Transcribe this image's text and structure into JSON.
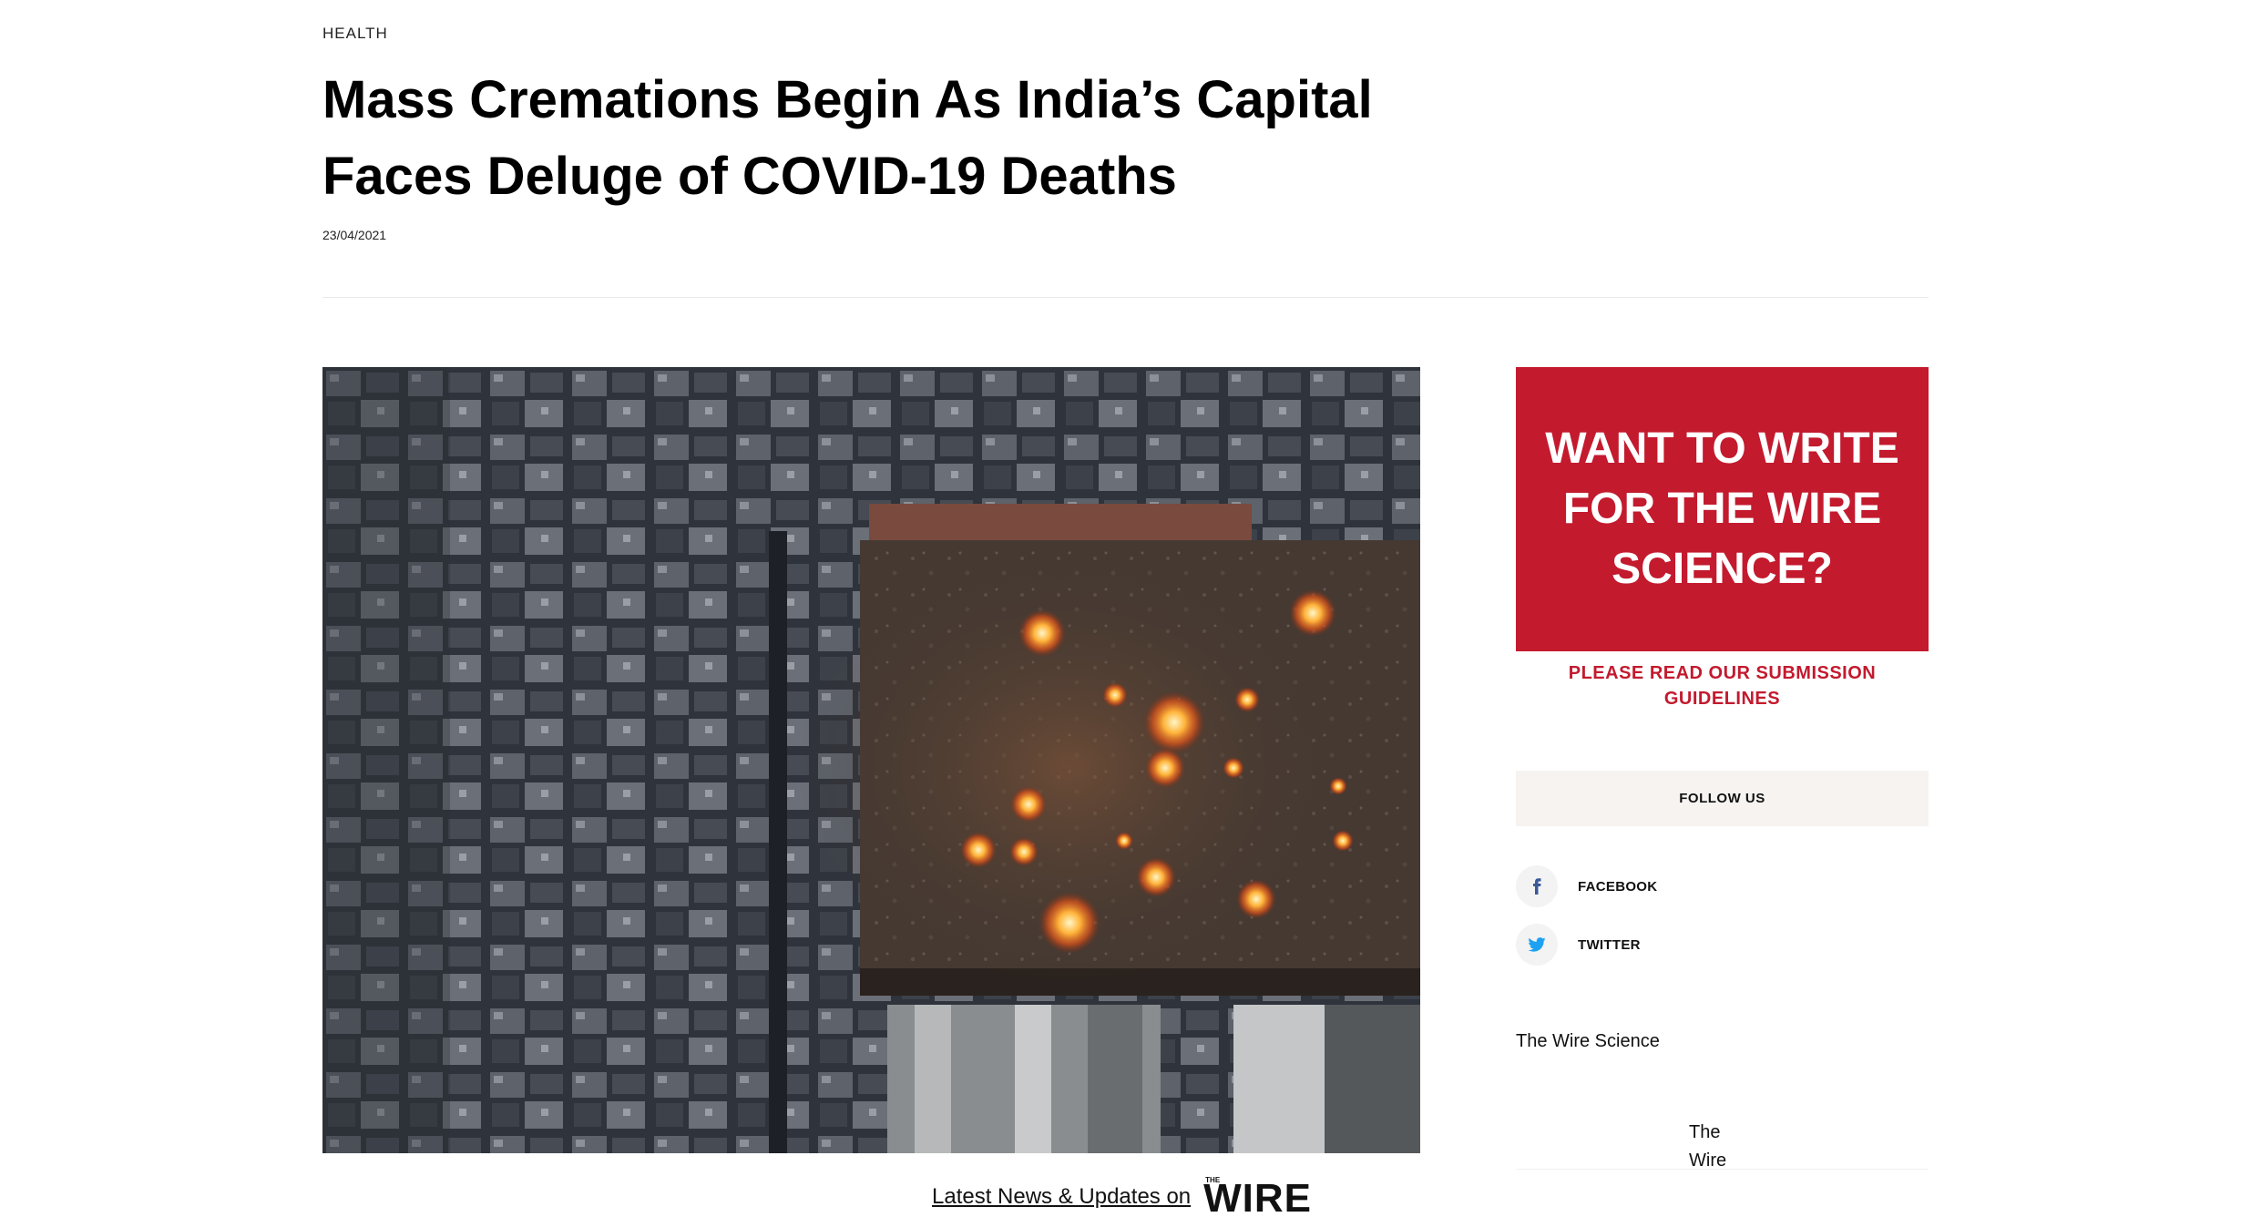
{
  "article": {
    "category": "HEALTH",
    "headline": "Mass Cremations Begin As India’s Capital Faces Deluge of COVID-19 Deaths",
    "date": "23/04/2021",
    "image_icon": "aerial-cremation-photo"
  },
  "latest": {
    "link_text": "Latest News & Updates on",
    "logo_small": "THE",
    "logo_word": "WIRE"
  },
  "sidebar": {
    "ad": {
      "headline": "WANT TO WRITE FOR THE WIRE SCIENCE?",
      "subline": "PLEASE READ OUR SUBMISSION GUIDELINES",
      "color": "#c31a2e"
    },
    "follow_label": "FOLLOW US",
    "social": [
      {
        "label": "FACEBOOK",
        "icon": "facebook-icon",
        "color": "#3b5998"
      },
      {
        "label": "TWITTER",
        "icon": "twitter-icon",
        "color": "#1da1f2"
      }
    ],
    "widget_title": "The Wire Science",
    "embed_text": "The Wire"
  }
}
